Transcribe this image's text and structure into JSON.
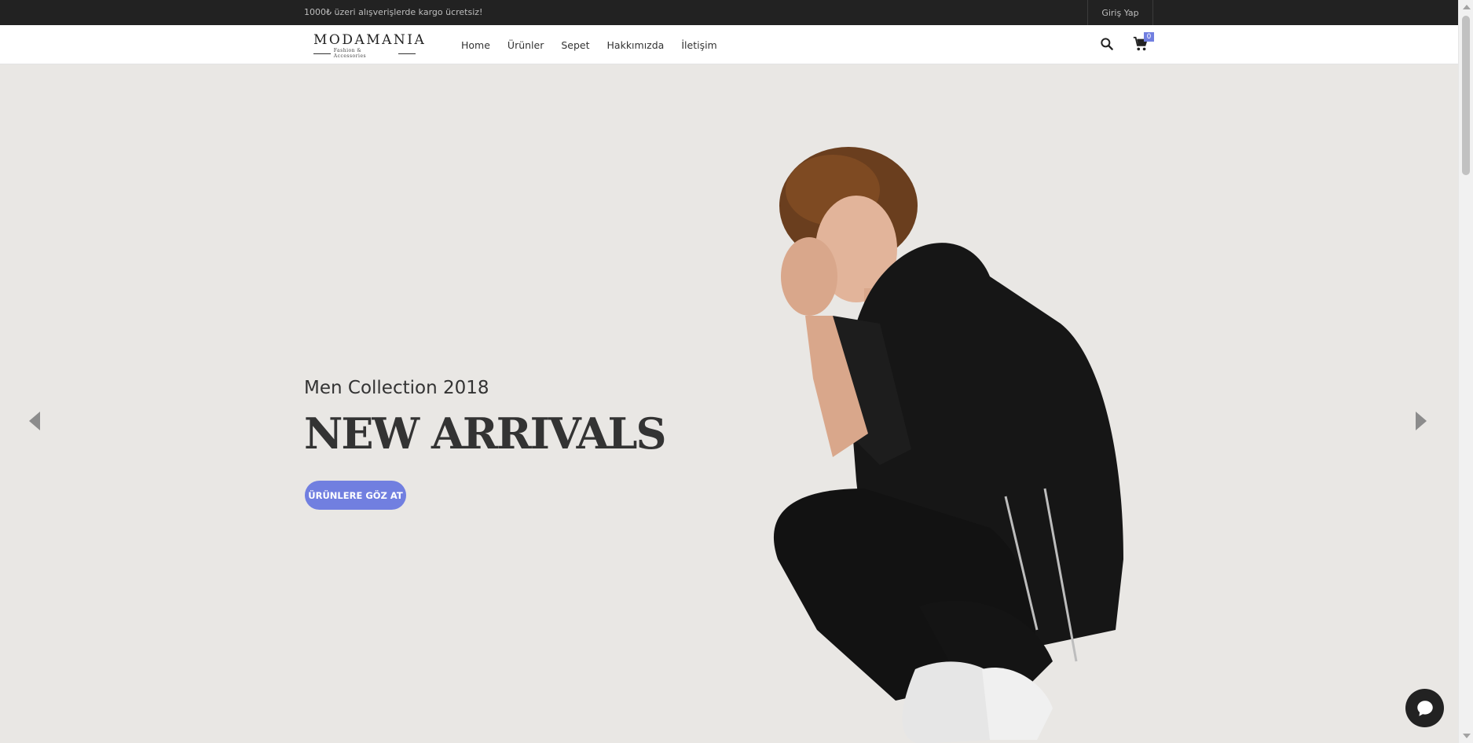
{
  "topbar": {
    "promo": "1000₺ üzeri alışverişlerde kargo ücretsiz!",
    "login": "Giriş Yap"
  },
  "header": {
    "logo": {
      "brand": "MODAMANIA",
      "tagline": "Fashion & Accessories"
    },
    "nav": [
      "Home",
      "Ürünler",
      "Sepet",
      "Hakkımızda",
      "İletişim"
    ],
    "cart_count": "0"
  },
  "hero": {
    "subtitle": "Men Collection 2018",
    "title": "NEW ARRIVALS",
    "cta": "ÜRÜNLERE GÖZ AT"
  },
  "colors": {
    "accent": "#717fe0",
    "topbar": "#222222",
    "hero_bg": "#e9e7e4"
  },
  "icons": [
    "search-icon",
    "cart-icon",
    "chevron-left-icon",
    "chevron-right-icon",
    "chat-icon"
  ]
}
